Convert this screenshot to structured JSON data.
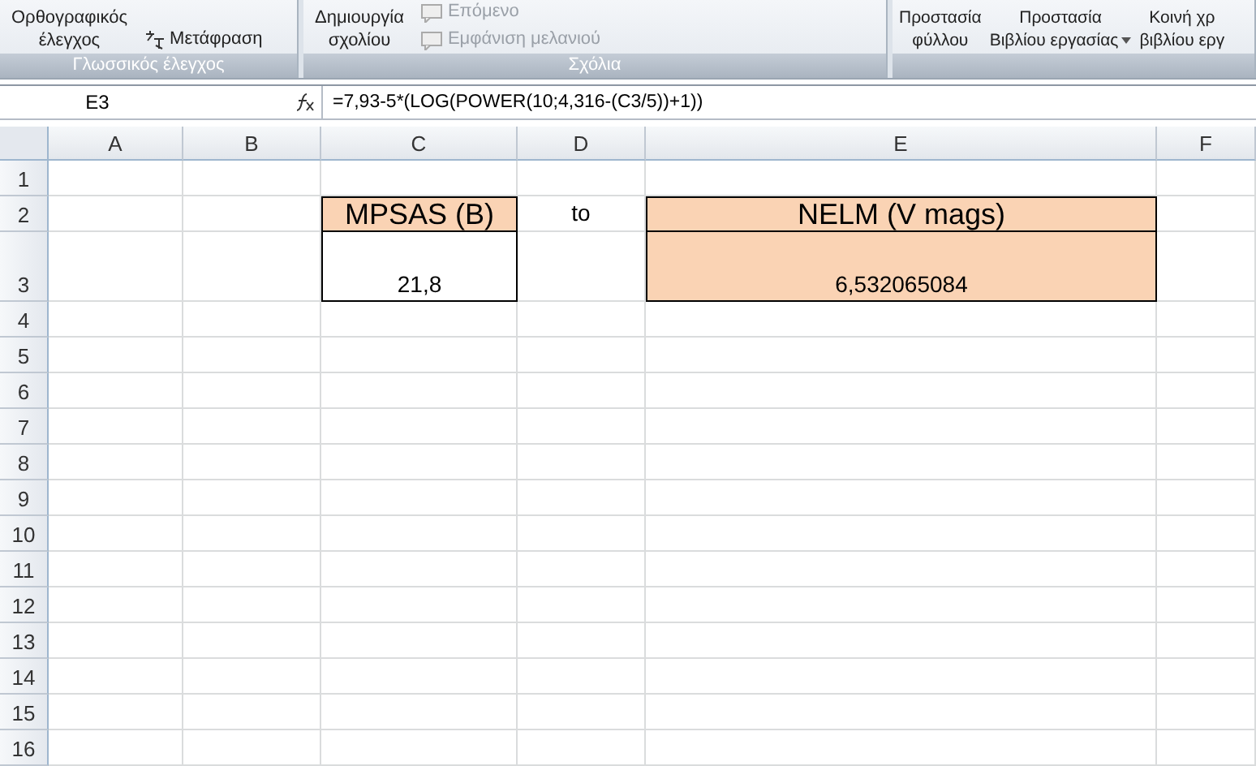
{
  "ribbon": {
    "groups": [
      {
        "label": "Γλωσσικός έλεγχος",
        "buttons": [
          {
            "kind": "large",
            "lines": [
              "Ορθογραφικός",
              "έλεγχος"
            ],
            "disabled": false
          },
          {
            "kind": "small",
            "lines": [
              "Μετάφραση"
            ],
            "disabled": false
          }
        ]
      },
      {
        "label": "Σχόλια",
        "buttons": [
          {
            "kind": "large",
            "lines": [
              "Δημιουργία",
              "σχολίου"
            ],
            "disabled": false
          },
          {
            "kind": "small",
            "lines": [
              "Επόμενο"
            ],
            "disabled": true
          },
          {
            "kind": "small",
            "lines": [
              "Εμφάνιση μελανιού"
            ],
            "disabled": true
          }
        ]
      },
      {
        "buttons": [
          {
            "kind": "large",
            "lines": [
              "Προστασία",
              "φύλλου"
            ],
            "disabled": false
          },
          {
            "kind": "dropdown",
            "lines": [
              "Προστασία",
              "Βιβλίου εργασίας"
            ],
            "disabled": false
          },
          {
            "kind": "large",
            "lines": [
              "Κοινή χρ",
              "βιβλίου εργ"
            ],
            "disabled": false
          }
        ]
      }
    ]
  },
  "formula_bar": {
    "name_box": "E3",
    "formula": "=7,93-5*(LOG(POWER(10;4,316-(C3/5))+1))"
  },
  "sheet": {
    "columns": [
      "A",
      "B",
      "C",
      "D",
      "E",
      "F"
    ],
    "rows": [
      {
        "number": "1",
        "tall": false,
        "cells": []
      },
      {
        "number": "2",
        "tall": false,
        "cells": [
          "",
          "",
          {
            "text": "MPSAS (B)",
            "kind": "heading"
          },
          {
            "text": "to",
            "kind": "plain"
          },
          {
            "text": "NELM (V mags)",
            "kind": "heading"
          },
          ""
        ]
      },
      {
        "number": "3",
        "tall": true,
        "cells": [
          "",
          "",
          {
            "text": "21,8",
            "kind": "boxed"
          },
          "",
          {
            "text": "6,532065084",
            "kind": "result"
          },
          ""
        ]
      },
      {
        "number": "4",
        "tall": false,
        "cells": []
      },
      {
        "number": "5",
        "tall": false,
        "cells": []
      },
      {
        "number": "6",
        "tall": false,
        "cells": []
      },
      {
        "number": "7",
        "tall": false,
        "cells": []
      },
      {
        "number": "8",
        "tall": false,
        "cells": []
      },
      {
        "number": "9",
        "tall": false,
        "cells": []
      },
      {
        "number": "10",
        "tall": false,
        "cells": []
      },
      {
        "number": "11",
        "tall": false,
        "cells": []
      },
      {
        "number": "12",
        "tall": false,
        "cells": []
      },
      {
        "number": "13",
        "tall": false,
        "cells": []
      },
      {
        "number": "14",
        "tall": false,
        "cells": []
      },
      {
        "number": "15",
        "tall": false,
        "cells": []
      },
      {
        "number": "16",
        "tall": false,
        "cells": []
      }
    ]
  }
}
